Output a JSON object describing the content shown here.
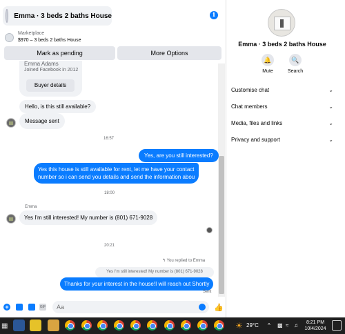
{
  "chat": {
    "title": "Emma · 3 beds 2 baths House",
    "marketplace_label": "Marketplace",
    "listing": "$970 – 3 beds 2 baths House",
    "mark_pending": "Mark as pending",
    "more_options": "More Options"
  },
  "card": {
    "name": "Emma Adams",
    "joined": "Joined Facebook in 2012",
    "buyer_details": "Buyer details"
  },
  "messages": {
    "m1": "Hello, is this still available?",
    "m2": "Message sent",
    "time1": "16:57",
    "m3": "Yes, are you still interested?",
    "m4_line1": "Yes this house is still available for rent, let me have your contact",
    "m4_line2": "number so i can send you details and send the information abou",
    "time2": "18:00",
    "sender": "Emma",
    "m5": "Yes I'm still interested! My number is (801) 671-9028",
    "time3": "20:21",
    "reply_note": "You replied to Emma",
    "reply_quote": "Yes I'm still interested! My number is (801) 671-9028",
    "m6": "Thanks for your interest in the house!I will reach out Shortly",
    "sent": "Sent"
  },
  "composer": {
    "placeholder": "Aa",
    "gif": "GIF"
  },
  "side": {
    "title": "Emma · 3 beds 2 baths House",
    "mute": "Mute",
    "search": "Search",
    "menu": [
      "Customise chat",
      "Chat members",
      "Media, files and links",
      "Privacy and support"
    ]
  },
  "taskbar": {
    "temp": "29°C",
    "time": "8:21 PM",
    "date": "10/4/2024",
    "tray": "^"
  },
  "icons": {
    "info": "info-icon",
    "mute": "bell-icon",
    "search": "search-icon",
    "like": "thumbs-up-icon"
  },
  "colors": {
    "accent": "#0a7cff",
    "bubble_in": "#f0f2f5"
  }
}
